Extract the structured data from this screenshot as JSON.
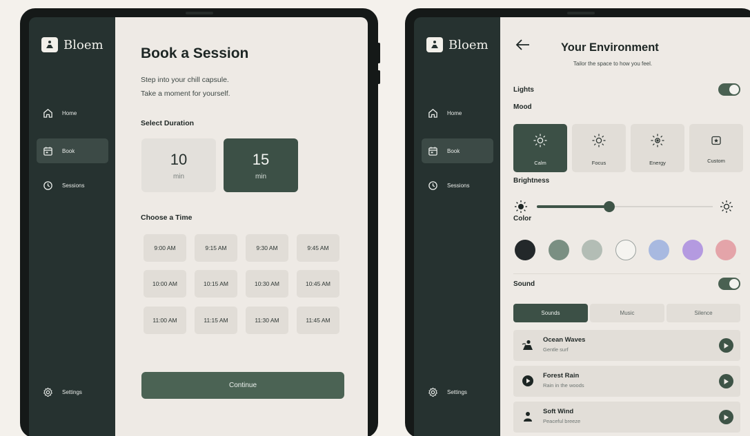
{
  "app": {
    "name": "Bloem"
  },
  "nav": {
    "home": "Home",
    "book": "Book",
    "sessions": "Sessions",
    "settings": "Settings"
  },
  "book_session": {
    "title": "Book a Session",
    "subtitle_line1": "Step into your chill capsule.",
    "subtitle_line2": "Take a moment for yourself.",
    "duration_heading": "Select Duration",
    "durations": [
      {
        "value": "10",
        "unit": "min",
        "selected": false
      },
      {
        "value": "15",
        "unit": "min",
        "selected": true
      }
    ],
    "time_heading": "Choose a Time",
    "times": [
      "9:00 AM",
      "9:15 AM",
      "9:30 AM",
      "9:45 AM",
      "10:00 AM",
      "10:15 AM",
      "10:30 AM",
      "10:45 AM",
      "11:00 AM",
      "11:15 AM",
      "11:30 AM",
      "11:45 AM"
    ],
    "continue_label": "Continue"
  },
  "environment": {
    "title": "Your Environment",
    "subtitle": "Tailor the space to how you feel.",
    "lights_label": "Lights",
    "lights_on": true,
    "mood_label": "Mood",
    "moods": [
      {
        "label": "Calm",
        "icon": "sun-icon",
        "selected": true
      },
      {
        "label": "Focus",
        "icon": "sun-icon",
        "selected": false
      },
      {
        "label": "Energy",
        "icon": "sun-bold-icon",
        "selected": false
      },
      {
        "label": "Custom",
        "icon": "star-box-icon",
        "selected": false
      }
    ],
    "brightness_label": "Brightness",
    "brightness_level": 0.41,
    "color_label": "Color",
    "colors": [
      "#23282a",
      "#7a8f82",
      "#b3bdb5",
      "#f5f4f0",
      "#a8b9e0",
      "#b49ae0",
      "#e4a4a9"
    ],
    "sound_label": "Sound",
    "sound_on": true,
    "sound_tabs": [
      {
        "label": "Sounds",
        "selected": true
      },
      {
        "label": "Music",
        "selected": false
      },
      {
        "label": "Silence",
        "selected": false
      }
    ],
    "tracks": [
      {
        "title": "Ocean Waves",
        "subtitle": "Gentle surf",
        "icon": "wave-icon"
      },
      {
        "title": "Forest Rain",
        "subtitle": "Rain in the woods",
        "icon": "rain-icon"
      },
      {
        "title": "Soft Wind",
        "subtitle": "Peaceful breeze",
        "icon": "wind-icon"
      }
    ]
  },
  "colors": {
    "sidebar": "#263230",
    "accent": "#3c5046",
    "background": "#eeeae5"
  }
}
